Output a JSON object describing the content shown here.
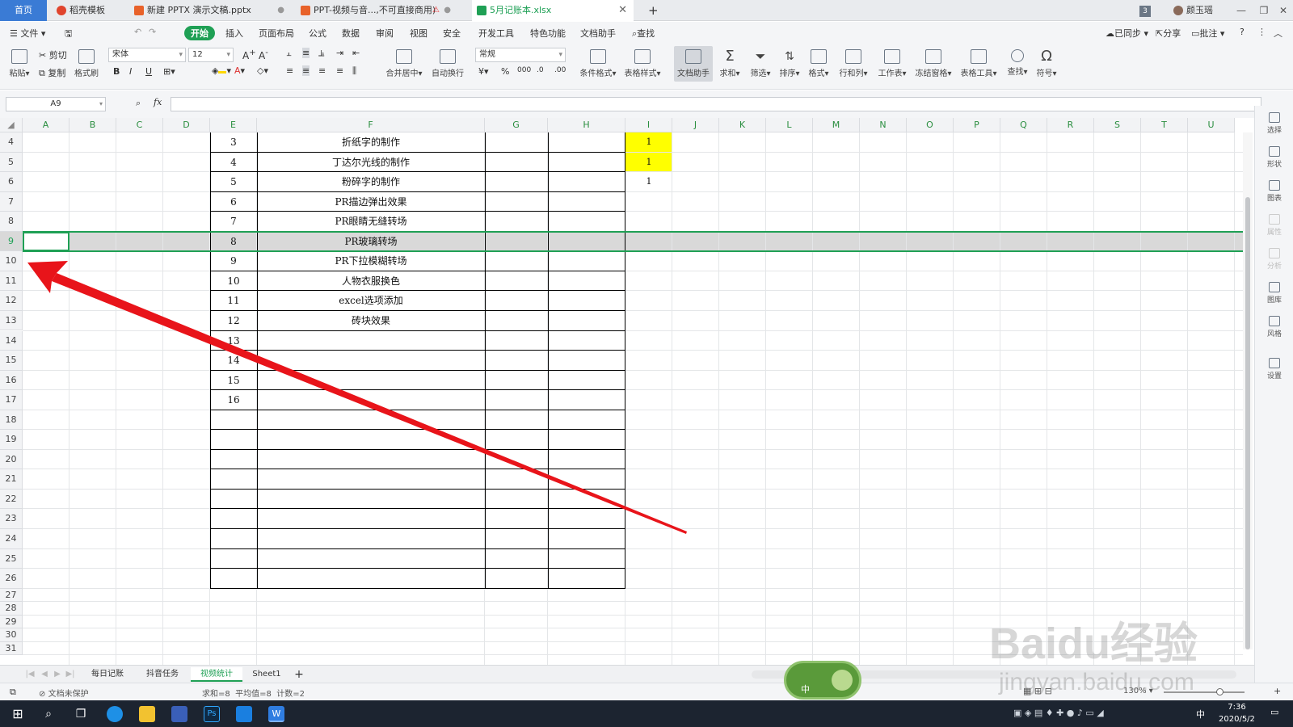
{
  "tabs": {
    "home": "首页",
    "t1": "稻壳模板",
    "t2": "新建 PPTX 演示文稿.pptx",
    "t3": "PPT-视频与音...,不可直接商用)",
    "t4": "5月记账本.xlsx",
    "add": "+"
  },
  "titlebar": {
    "badge": "3",
    "user": "颜玉瑶"
  },
  "menu": {
    "file": "文件",
    "start": "开始",
    "insert": "插入",
    "layout": "页面布局",
    "formula": "公式",
    "data": "数据",
    "review": "审阅",
    "view": "视图",
    "security": "安全",
    "dev": "开发工具",
    "special": "特色功能",
    "assistant": "文档助手",
    "search": "查找",
    "synced": "已同步",
    "share": "分享",
    "comment": "批注"
  },
  "ribbon": {
    "paste": "粘贴",
    "cut": "剪切",
    "copy": "复制",
    "format_painter": "格式刷",
    "font_name": "宋体",
    "font_size": "12",
    "merge": "合并居中",
    "wrap": "自动换行",
    "number_format": "常规",
    "cond_format": "条件格式",
    "table_style": "表格样式",
    "doc_assistant": "文档助手",
    "sum": "求和",
    "filter": "筛选",
    "sort": "排序",
    "format": "格式",
    "rowcol": "行和列",
    "worksheet": "工作表",
    "freeze": "冻结窗格",
    "table_tools": "表格工具",
    "find": "查找",
    "symbol": "符号"
  },
  "formula_bar": {
    "name_box": "A9",
    "fx": "fx",
    "value": ""
  },
  "columns": [
    "A",
    "B",
    "C",
    "D",
    "E",
    "F",
    "G",
    "H",
    "I",
    "J",
    "K",
    "L",
    "M",
    "N",
    "O",
    "P",
    "Q",
    "R",
    "S",
    "T",
    "U"
  ],
  "rows": [
    "4",
    "5",
    "6",
    "7",
    "8",
    "9",
    "10",
    "11",
    "12",
    "13",
    "14",
    "15",
    "16",
    "17",
    "18",
    "19",
    "20",
    "21",
    "22",
    "23",
    "24",
    "25",
    "26",
    "27",
    "28",
    "29",
    "30",
    "31"
  ],
  "table": [
    {
      "e": "3",
      "f": "折纸字的制作"
    },
    {
      "e": "4",
      "f": "丁达尔光线的制作"
    },
    {
      "e": "5",
      "f": "粉碎字的制作"
    },
    {
      "e": "6",
      "f": "PR描边弹出效果"
    },
    {
      "e": "7",
      "f": "PR眼睛无缝转场"
    },
    {
      "e": "8",
      "f": "PR玻璃转场"
    },
    {
      "e": "9",
      "f": "PR下拉模糊转场"
    },
    {
      "e": "10",
      "f": "人物衣服换色"
    },
    {
      "e": "11",
      "f": "excel选项添加"
    },
    {
      "e": "12",
      "f": "砖块效果"
    },
    {
      "e": "13",
      "f": ""
    },
    {
      "e": "14",
      "f": ""
    },
    {
      "e": "15",
      "f": ""
    },
    {
      "e": "16",
      "f": ""
    }
  ],
  "col_i": [
    "1",
    "1",
    "1"
  ],
  "colors": {
    "highlight": "#ffff00",
    "accent": "#1fa055",
    "arrow": "#e8141a",
    "selected_row": "#d9d9d9"
  },
  "sheets": {
    "s1": "每日记账",
    "s2": "抖音任务",
    "s3": "视频统计",
    "s4": "Sheet1",
    "add": "+"
  },
  "status": {
    "protect": "文档未保护",
    "stats": "求和=8  平均值=8  计数=2",
    "zoom": "130%",
    "input_mode": "中"
  },
  "right_panel": [
    "选择",
    "形状",
    "图表",
    "属性",
    "分析",
    "图库",
    "风格",
    "设置"
  ],
  "taskbar": {
    "time": "7:36",
    "date": "2020/5/2",
    "ime": "中"
  },
  "watermark": {
    "brand": "Baidu经验",
    "url": "jingyan.baidu.com"
  }
}
